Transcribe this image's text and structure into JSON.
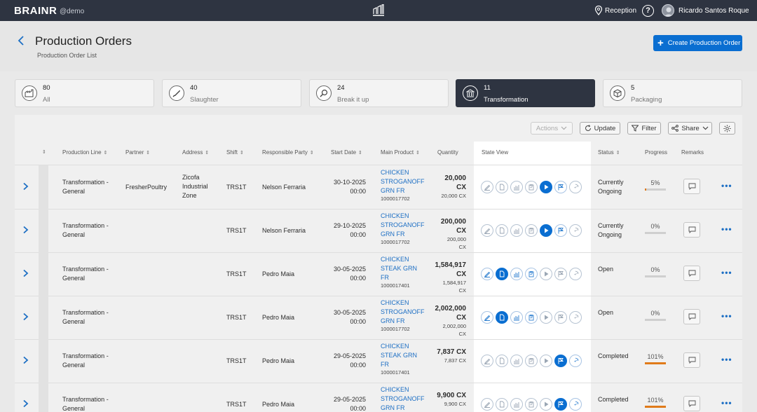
{
  "app": {
    "logo": "BRAINR",
    "env": "@demo"
  },
  "topbar": {
    "location": "Reception",
    "help": "?",
    "user": "Ricardo Santos Roque"
  },
  "header": {
    "title": "Production Orders",
    "subtitle": "Production Order List",
    "create_label": "Create Production Order"
  },
  "tiles": [
    {
      "count": "80",
      "label": "All",
      "icon": "factory-icon"
    },
    {
      "count": "40",
      "label": "Slaughter",
      "icon": "knife-icon"
    },
    {
      "count": "24",
      "label": "Break it up",
      "icon": "search-icon"
    },
    {
      "count": "11",
      "label": "Transformation",
      "icon": "building-icon",
      "active": true
    },
    {
      "count": "5",
      "label": "Packaging",
      "icon": "box-icon"
    }
  ],
  "toolbar": {
    "actions": "Actions",
    "update": "Update",
    "filter": "Filter",
    "share": "Share"
  },
  "columns": [
    "Production Line",
    "Partner",
    "Address",
    "Shift",
    "Responsible Party",
    "Start Date",
    "Main Product",
    "Quantity",
    "State View",
    "Status",
    "Progress",
    "Remarks"
  ],
  "rows": [
    {
      "line1": "Transformation -",
      "line2": "General",
      "partner": "FresherPoultry",
      "addr1": "Zicofa",
      "addr2": "Industrial",
      "addr3": "Zone",
      "shift": "TRS1T",
      "party": "Nelson Ferraria",
      "date1": "30-10-2025",
      "date2": "00:00",
      "prod1": "CHICKEN",
      "prod2": "STROGANOFF",
      "prod3": "GRN FR",
      "code": "1000017702",
      "qty1": "20,000",
      "qty2": "CX",
      "qty3": "20,000 CX",
      "qty4": "",
      "status1": "Currently",
      "status2": "Ongoing",
      "progress": "5%",
      "progress_value": 5
    },
    {
      "line1": "Transformation -",
      "line2": "General",
      "partner": "",
      "addr1": "",
      "addr2": "",
      "addr3": "",
      "shift": "TRS1T",
      "party": "Nelson Ferraria",
      "date1": "29-10-2025",
      "date2": "00:00",
      "prod1": "CHICKEN",
      "prod2": "STROGANOFF",
      "prod3": "GRN FR",
      "code": "1000017702",
      "qty1": "200,000",
      "qty2": "CX",
      "qty3": "200,000",
      "qty4": "CX",
      "status1": "Currently",
      "status2": "Ongoing",
      "progress": "0%",
      "progress_value": 0
    },
    {
      "line1": "Transformation -",
      "line2": "General",
      "partner": "",
      "addr1": "",
      "addr2": "",
      "addr3": "",
      "shift": "TRS1T",
      "party": "Pedro Maia",
      "date1": "30-05-2025",
      "date2": "00:00",
      "prod1": "CHICKEN",
      "prod2": "STEAK GRN",
      "prod3": "FR",
      "code": "1000017401",
      "qty1": "1,584,917",
      "qty2": "CX",
      "qty3": "1,584,917",
      "qty4": "CX",
      "status1": "Open",
      "status2": "",
      "progress": "0%",
      "progress_value": 0
    },
    {
      "line1": "Transformation -",
      "line2": "General",
      "partner": "",
      "addr1": "",
      "addr2": "",
      "addr3": "",
      "shift": "TRS1T",
      "party": "Pedro Maia",
      "date1": "30-05-2025",
      "date2": "00:00",
      "prod1": "CHICKEN",
      "prod2": "STROGANOFF",
      "prod3": "GRN FR",
      "code": "1000017702",
      "qty1": "2,002,000",
      "qty2": "CX",
      "qty3": "2,002,000",
      "qty4": "CX",
      "status1": "Open",
      "status2": "",
      "progress": "0%",
      "progress_value": 0
    },
    {
      "line1": "Transformation -",
      "line2": "General",
      "partner": "",
      "addr1": "",
      "addr2": "",
      "addr3": "",
      "shift": "TRS1T",
      "party": "Pedro Maia",
      "date1": "29-05-2025",
      "date2": "00:00",
      "prod1": "CHICKEN",
      "prod2": "STEAK GRN",
      "prod3": "FR",
      "code": "1000017401",
      "qty1": "7,837 CX",
      "qty2": "",
      "qty3": "7,837 CX",
      "qty4": "",
      "status1": "Completed",
      "status2": "",
      "progress": "101%",
      "progress_value": 101
    },
    {
      "line1": "Transformation -",
      "line2": "General",
      "partner": "",
      "addr1": "",
      "addr2": "",
      "addr3": "",
      "shift": "TRS1T",
      "party": "Pedro Maia",
      "date1": "29-05-2025",
      "date2": "00:00",
      "prod1": "CHICKEN",
      "prod2": "STROGANOFF",
      "prod3": "GRN FR",
      "code": "",
      "qty1": "9,900 CX",
      "qty2": "",
      "qty3": "9,900 CX",
      "qty4": "",
      "status1": "Completed",
      "status2": "",
      "progress": "101%",
      "progress_value": 101
    }
  ],
  "state_patterns": [
    [
      "idle",
      "idle",
      "idle",
      "idle",
      "play-on",
      "flag-done",
      "idle"
    ],
    [
      "idle",
      "idle",
      "idle",
      "idle",
      "play-on",
      "flag-done",
      "idle"
    ],
    [
      "done",
      "doc-on",
      "done",
      "done",
      "idle",
      "idle",
      "idle"
    ],
    [
      "done",
      "doc-on",
      "done",
      "done",
      "idle",
      "idle",
      "idle"
    ],
    [
      "idle",
      "idle",
      "idle",
      "idle",
      "idle",
      "flag-on",
      "done"
    ],
    [
      "idle",
      "idle",
      "idle",
      "idle",
      "idle",
      "flag-on",
      "done"
    ]
  ]
}
